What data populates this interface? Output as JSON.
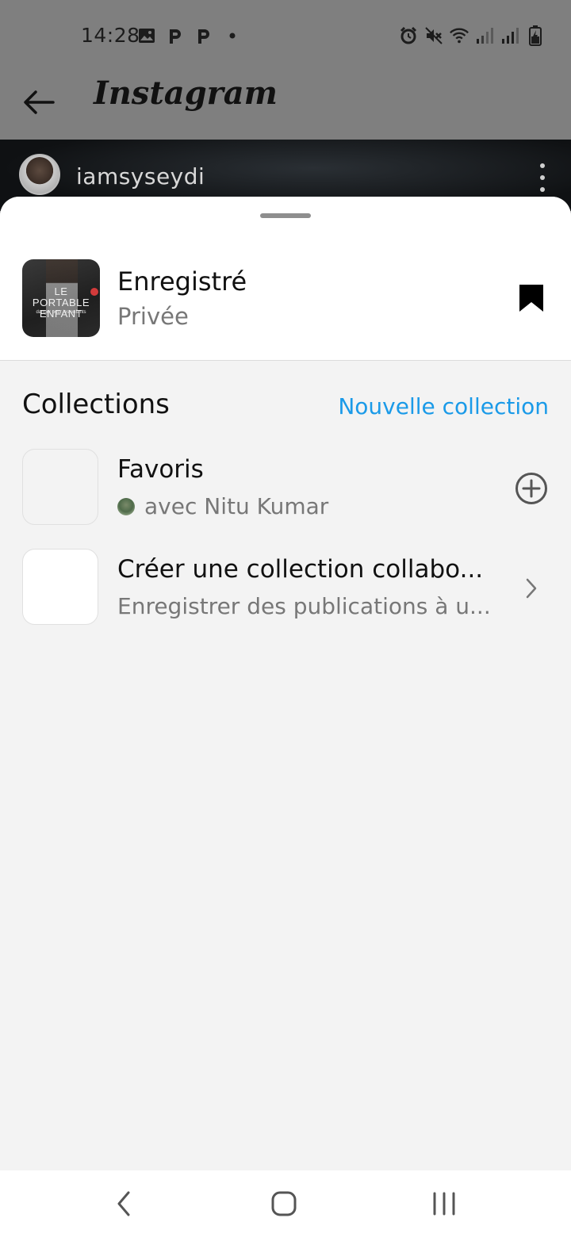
{
  "status_bar": {
    "time": "14:28",
    "left_icons": [
      "image-icon",
      "p-icon",
      "p-icon",
      "dot-icon"
    ],
    "right_icons": [
      "alarm-icon",
      "mute-icon",
      "wifi-icon",
      "signal-icon",
      "signal-icon",
      "battery-icon"
    ]
  },
  "header": {
    "title": "Instagram",
    "back_icon": "arrow-left-icon"
  },
  "post": {
    "username": "iamsyseydi",
    "more_icon": "more-vertical-icon"
  },
  "sheet": {
    "saved": {
      "title": "Enregistré",
      "subtitle": "Privée",
      "thumb_text": "LE PORTABLE ENFANT",
      "thumb_subtext": "danger pour les enfants",
      "icon": "bookmark-filled-icon"
    },
    "collections": {
      "title": "Collections",
      "new_label": "Nouvelle collection",
      "items": [
        {
          "title": "Favoris",
          "subtitle": "avec Nitu Kumar",
          "action_icon": "plus-circle-icon"
        },
        {
          "title": "Créer une collection collabo...",
          "subtitle": "Enregistrer des publications à u...",
          "action_icon": "chevron-right-icon"
        }
      ]
    }
  },
  "nav_bar": {
    "icons": [
      "back-nav-icon",
      "home-nav-icon",
      "recents-nav-icon"
    ]
  },
  "colors": {
    "accent": "#1a9ae8",
    "overlay": "#7f7f7f",
    "sheet_bg": "#f3f3f3"
  }
}
